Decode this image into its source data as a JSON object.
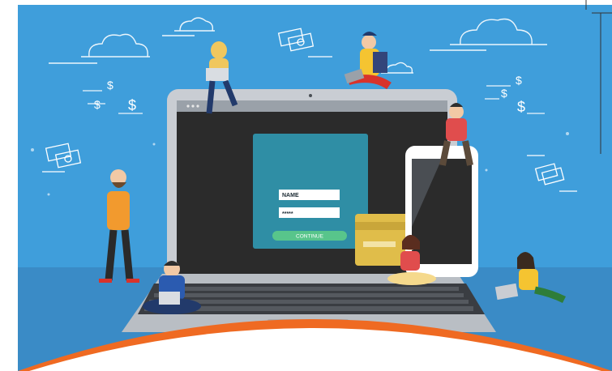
{
  "login_form": {
    "name_label": "NAME",
    "password_mask": "*****",
    "continue_label": "CONTINUE"
  },
  "colors": {
    "sky": "#3f9edb",
    "ground": "#3a8bc6",
    "laptop_body": "#c9cdd3",
    "screen": "#2b2b2b",
    "form_panel": "#2f8ea5",
    "continue_button": "#58c58b",
    "credit_card": "#e0bd4a",
    "orange_arc": "#ef6a22"
  },
  "icons": [
    "cloud-icon",
    "dollar-sign-icon",
    "money-bill-icon",
    "credit-card-icon",
    "camera-dot-icon"
  ]
}
